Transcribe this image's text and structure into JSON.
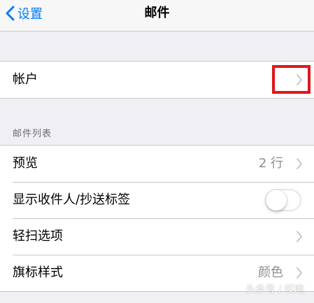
{
  "navbar": {
    "back_label": "设置",
    "title": "邮件"
  },
  "account_section": {
    "items": [
      {
        "label": "帐户"
      }
    ]
  },
  "mail_list_section": {
    "header": "邮件列表",
    "items": [
      {
        "label": "预览",
        "value": "2 行"
      },
      {
        "label": "显示收件人/抄送标签",
        "toggle_on": false
      },
      {
        "label": "轻扫选项"
      },
      {
        "label": "旗标样式",
        "value": "颜色"
      }
    ]
  },
  "watermark": "头条号 / 哎咆",
  "colors": {
    "accent": "#007aff",
    "highlight": "#e0161e",
    "background": "#efeff4",
    "secondary_text": "#8e8e93"
  }
}
